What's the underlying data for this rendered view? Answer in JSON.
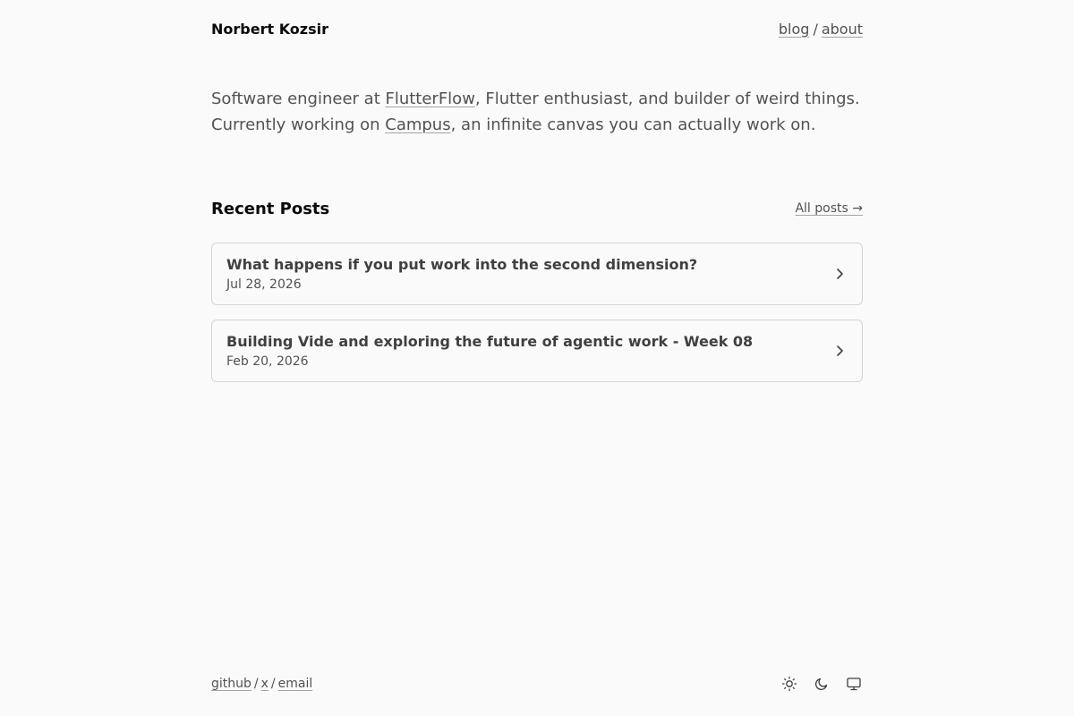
{
  "header": {
    "name": "Norbert Kozsir",
    "nav": [
      {
        "label": "blog"
      },
      {
        "label": "about"
      }
    ],
    "nav_sep": "/"
  },
  "intro": {
    "line1_pre": "Software engineer at ",
    "line1_link": "FlutterFlow",
    "line1_post": ", Flutter enthusiast, and builder of weird things.",
    "line2_pre": "Currently working on ",
    "line2_link": "Campus",
    "line2_post": ", an infinite canvas you can actually work on."
  },
  "recent": {
    "title": "Recent Posts",
    "all_posts": "All posts →",
    "posts": [
      {
        "title": "What happens if you put work into the second dimension?",
        "date": "Jul 28, 2026"
      },
      {
        "title": "Building Vide and exploring the future of agentic work - Week 08",
        "date": "Feb 20, 2026"
      }
    ]
  },
  "footer": {
    "links": [
      {
        "label": "github"
      },
      {
        "label": "x"
      },
      {
        "label": "email"
      }
    ],
    "sep": "/",
    "theme_icons": [
      "sun-icon",
      "moon-icon",
      "monitor-icon"
    ]
  },
  "colors": {
    "background": "#fafafa",
    "text": "#262626",
    "muted": "#525252",
    "border": "#d4d4d4"
  }
}
